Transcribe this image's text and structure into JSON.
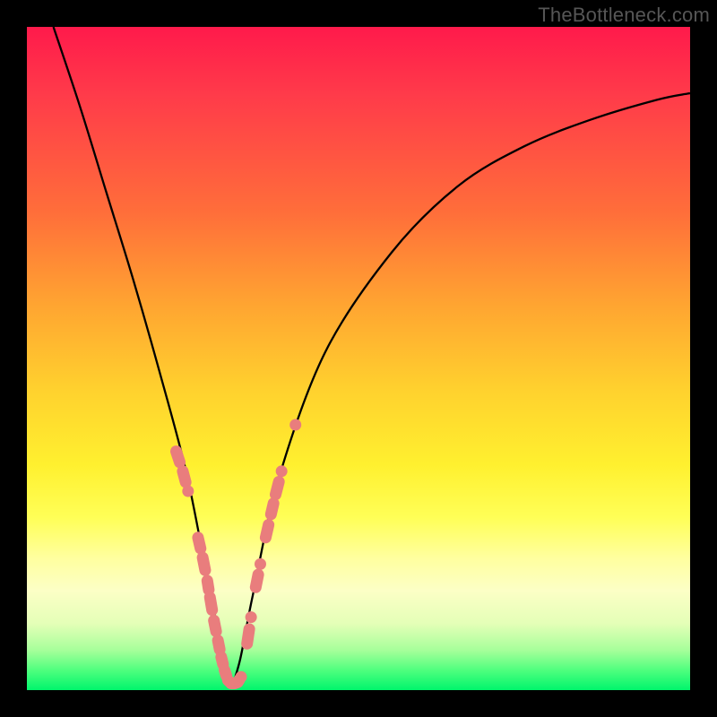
{
  "watermark": "TheBottleneck.com",
  "chart_data": {
    "type": "line",
    "title": "",
    "xlabel": "",
    "ylabel": "",
    "xlim": [
      0,
      100
    ],
    "ylim": [
      0,
      100
    ],
    "annotations": [],
    "series": [
      {
        "name": "bottleneck-curve",
        "x": [
          4,
          8,
          12,
          16,
          20,
          24,
          27,
          29,
          30.5,
          32,
          34,
          38,
          45,
          55,
          65,
          75,
          85,
          95,
          100
        ],
        "y": [
          100,
          88,
          75,
          62,
          48,
          33,
          18,
          8,
          1,
          4,
          14,
          32,
          51,
          66,
          76,
          82,
          86,
          89,
          90
        ]
      }
    ],
    "marker_clusters": [
      {
        "name": "left-branch-markers",
        "color": "#e97d7d",
        "points": [
          {
            "x": 22.5,
            "y": 36
          },
          {
            "x": 23.5,
            "y": 33
          },
          {
            "x": 24.3,
            "y": 30
          },
          {
            "x": 25.8,
            "y": 23
          },
          {
            "x": 26.5,
            "y": 20
          },
          {
            "x": 27.2,
            "y": 16.5
          },
          {
            "x": 27.6,
            "y": 14
          },
          {
            "x": 28.2,
            "y": 10.5
          },
          {
            "x": 28.8,
            "y": 7.5
          },
          {
            "x": 29.3,
            "y": 5
          },
          {
            "x": 29.8,
            "y": 3
          },
          {
            "x": 30.3,
            "y": 1.5
          },
          {
            "x": 30.8,
            "y": 1
          },
          {
            "x": 31.3,
            "y": 1
          },
          {
            "x": 31.8,
            "y": 1.2
          },
          {
            "x": 32.3,
            "y": 2
          }
        ]
      },
      {
        "name": "right-branch-markers",
        "color": "#e97d7d",
        "points": [
          {
            "x": 33.2,
            "y": 7
          },
          {
            "x": 33.8,
            "y": 11
          },
          {
            "x": 34.5,
            "y": 15.5
          },
          {
            "x": 35.2,
            "y": 19
          },
          {
            "x": 36.0,
            "y": 23
          },
          {
            "x": 36.8,
            "y": 26.5
          },
          {
            "x": 37.5,
            "y": 29.5
          },
          {
            "x": 38.4,
            "y": 33
          },
          {
            "x": 40.5,
            "y": 40
          }
        ]
      }
    ]
  }
}
